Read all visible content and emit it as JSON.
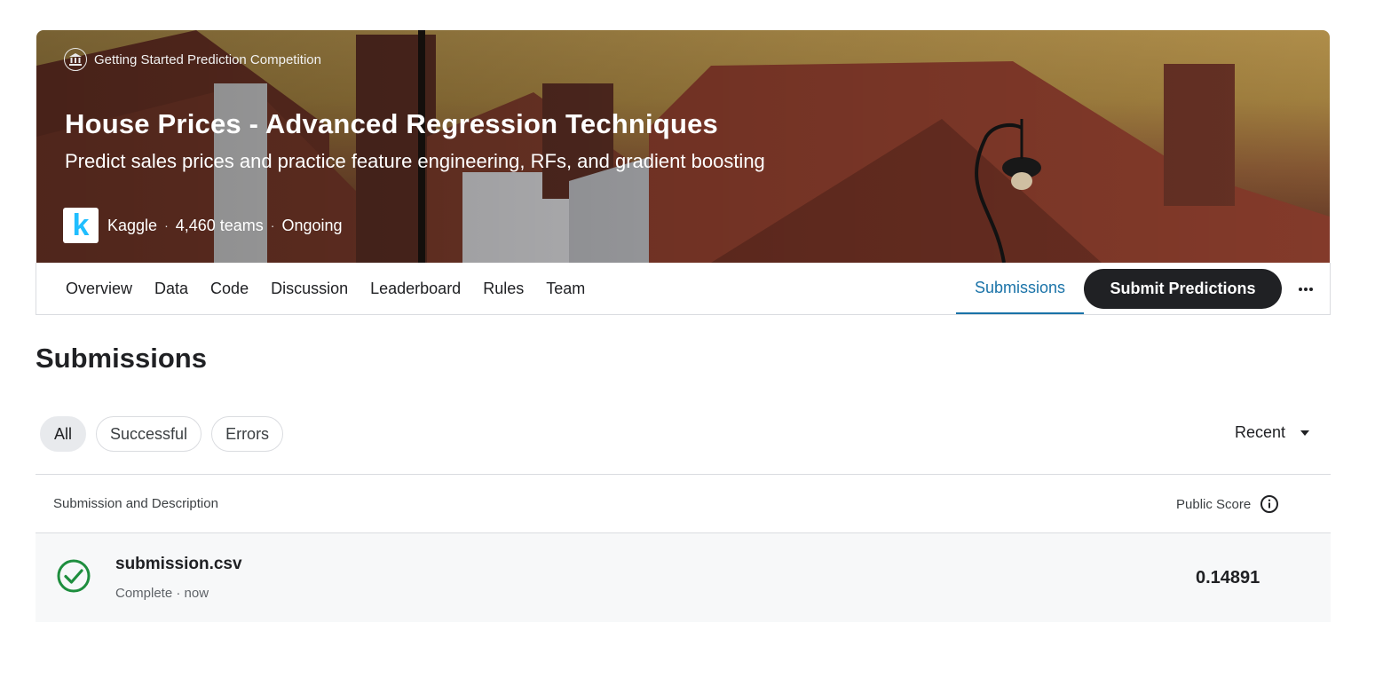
{
  "hero": {
    "competition_type": "Getting Started Prediction Competition",
    "title": "House Prices - Advanced Regression Techniques",
    "subtitle": "Predict sales prices and practice feature engineering, RFs, and gradient boosting",
    "logo_letter": "k",
    "host": "Kaggle",
    "teams": "4,460 teams",
    "status": "Ongoing",
    "separator": "·"
  },
  "tabs": {
    "items": [
      "Overview",
      "Data",
      "Code",
      "Discussion",
      "Leaderboard",
      "Rules",
      "Team"
    ],
    "active": "Submissions",
    "submit_label": "Submit Predictions",
    "more_icon": "more-horiz-icon"
  },
  "page": {
    "title": "Submissions"
  },
  "filters": {
    "chips": [
      "All",
      "Successful",
      "Errors"
    ],
    "selected": "All",
    "sort_label": "Recent"
  },
  "table": {
    "col_left": "Submission and Description",
    "col_right": "Public Score",
    "rows": [
      {
        "file": "submission.csv",
        "status": "Complete · now",
        "score": "0.14891",
        "status_icon": "check-circle-icon"
      }
    ]
  },
  "colors": {
    "accent": "#1a73a8",
    "success": "#1e8e3e",
    "button": "#202124",
    "kaggle": "#20beff"
  }
}
